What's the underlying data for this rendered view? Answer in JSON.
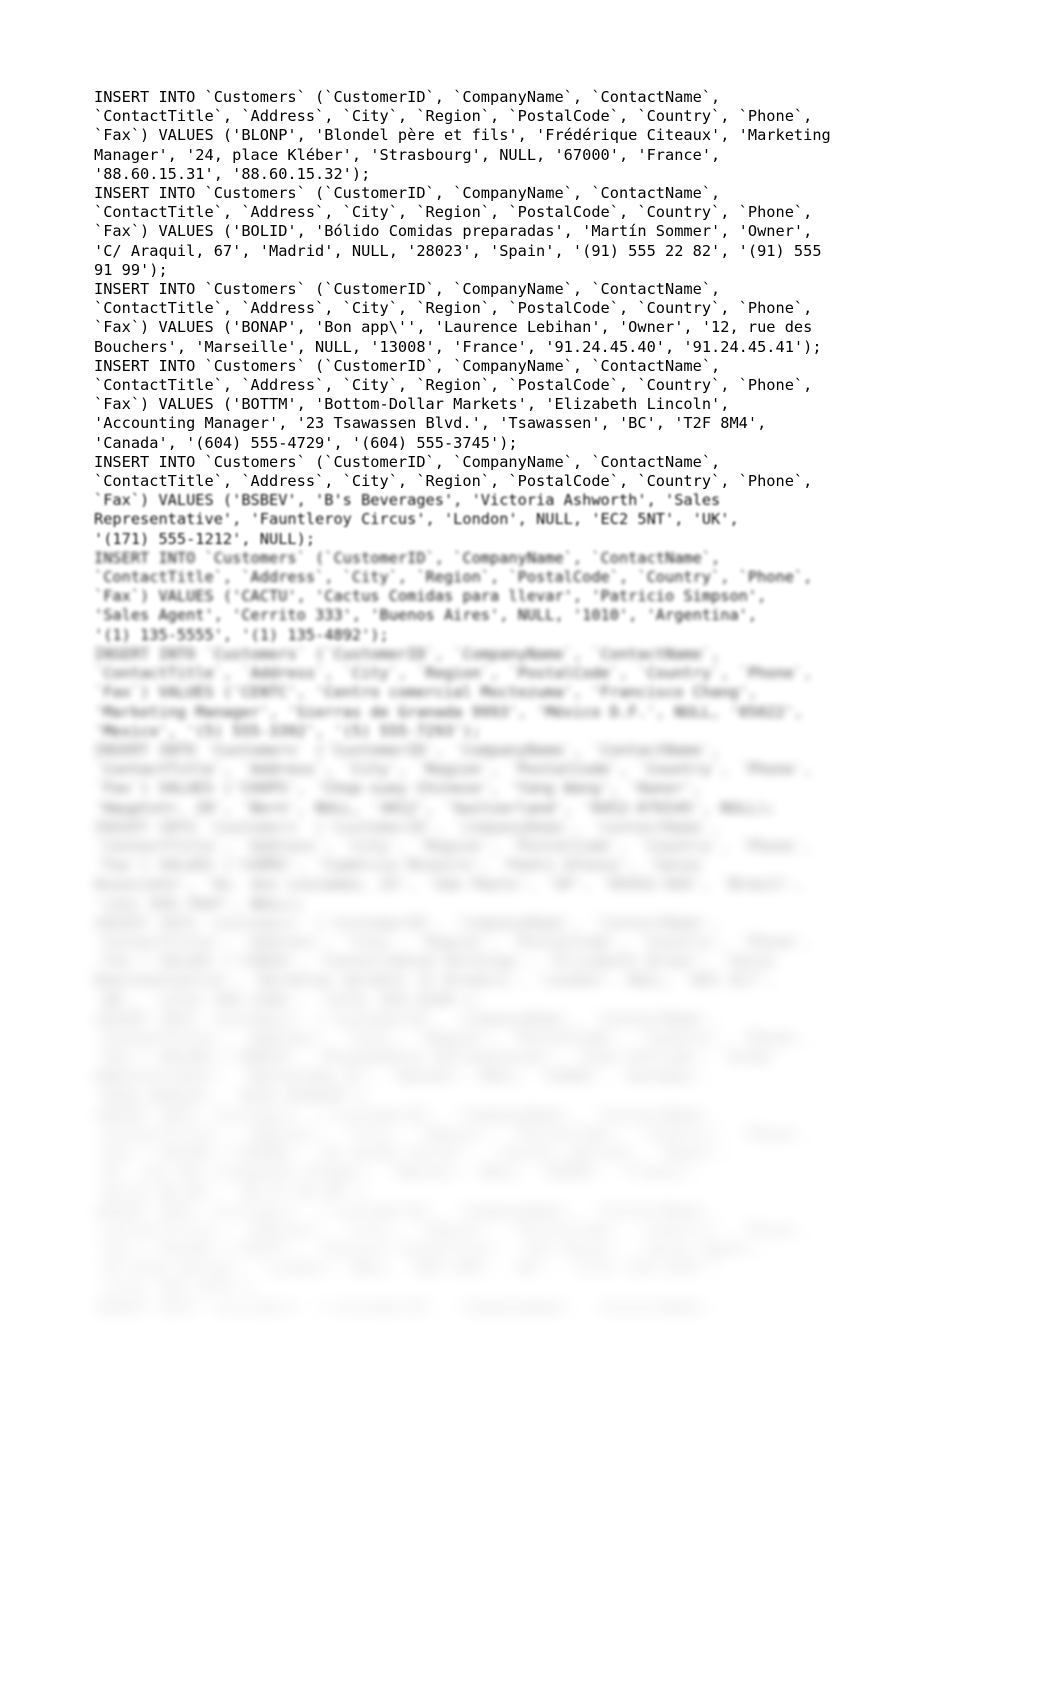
{
  "document": {
    "type": "sql-dump",
    "text_color": "#000000",
    "background_color": "#ffffff",
    "font_size_px": 15.3,
    "line_height_px": 19.2,
    "statements": [
      {
        "id": "stmt-blonp",
        "sharp": true,
        "lines": [
          "INSERT INTO `Customers` (`CustomerID`, `CompanyName`, `ContactName`,",
          "`ContactTitle`, `Address`, `City`, `Region`, `PostalCode`, `Country`, `Phone`,",
          "`Fax`) VALUES ('BLONP', 'Blondel père et fils', 'Frédérique Citeaux', 'Marketing",
          "Manager', '24, place Kléber', 'Strasbourg', NULL, '67000', 'France',",
          "'88.60.15.31', '88.60.15.32');"
        ]
      },
      {
        "id": "stmt-bolid",
        "sharp": true,
        "lines": [
          "INSERT INTO `Customers` (`CustomerID`, `CompanyName`, `ContactName`,",
          "`ContactTitle`, `Address`, `City`, `Region`, `PostalCode`, `Country`, `Phone`,",
          "`Fax`) VALUES ('BOLID', 'Bólido Comidas preparadas', 'Martín Sommer', 'Owner',",
          "'C/ Araquil, 67', 'Madrid', NULL, '28023', 'Spain', '(91) 555 22 82', '(91) 555",
          "91 99');"
        ]
      },
      {
        "id": "stmt-bonap",
        "sharp": true,
        "lines": [
          "INSERT INTO `Customers` (`CustomerID`, `CompanyName`, `ContactName`,",
          "`ContactTitle`, `Address`, `City`, `Region`, `PostalCode`, `Country`, `Phone`,",
          "`Fax`) VALUES ('BONAP', 'Bon app\\'', 'Laurence Lebihan', 'Owner', '12, rue des",
          "Bouchers', 'Marseille', NULL, '13008', 'France', '91.24.45.40', '91.24.45.41');"
        ]
      },
      {
        "id": "stmt-bottm",
        "sharp": true,
        "lines": [
          "INSERT INTO `Customers` (`CustomerID`, `CompanyName`, `ContactName`,",
          "`ContactTitle`, `Address`, `City`, `Region`, `PostalCode`, `Country`, `Phone`,",
          "`Fax`) VALUES ('BOTTM', 'Bottom-Dollar Markets', 'Elizabeth Lincoln',",
          "'Accounting Manager', '23 Tsawassen Blvd.', 'Tsawassen', 'BC', 'T2F 8M4',",
          "'Canada', '(604) 555-4729', '(604) 555-3745');"
        ]
      },
      {
        "id": "stmt-bsbev-header",
        "sharp": true,
        "lines": [
          "INSERT INTO `Customers` (`CustomerID`, `CompanyName`, `ContactName`,",
          "`ContactTitle`, `Address`, `City`, `Region`, `PostalCode`, `Country`, `Phone`,"
        ]
      }
    ],
    "blurred_continuation": {
      "note": "Remaining statements are rendered out-of-focus with increasing blur toward the bottom of the page.",
      "blocks": [
        {
          "blur_level": 1,
          "lines": [
            "`Fax`) VALUES ('BSBEV', 'B's Beverages', 'Victoria Ashworth', 'Sales",
            "Representative', 'Fauntleroy Circus', 'London', NULL, 'EC2 5NT', 'UK',",
            "'(171) 555-1212', NULL);"
          ]
        },
        {
          "blur_level": 2,
          "lines": [
            "INSERT INTO `Customers` (`CustomerID`, `CompanyName`, `ContactName`,",
            "`ContactTitle`, `Address`, `City`, `Region`, `PostalCode`, `Country`, `Phone`,",
            "`Fax`) VALUES ('CACTU', 'Cactus Comidas para llevar', 'Patricio Simpson',",
            "'Sales Agent', 'Cerrito 333', 'Buenos Aires', NULL, '1010', 'Argentina',",
            "'(1) 135-5555', '(1) 135-4892');"
          ]
        },
        {
          "blur_level": 4,
          "lines": [
            "INSERT INTO `Customers` (`CustomerID`, `CompanyName`, `ContactName`,",
            "`ContactTitle`, `Address`, `City`, `Region`, `PostalCode`, `Country`, `Phone`,",
            "`Fax`) VALUES ('CENTC', 'Centro comercial Moctezuma', 'Francisco Chang',",
            "'Marketing Manager', 'Sierras de Granada 9993', 'México D.F.', NULL, '05022',",
            "'Mexico', '(5) 555-3392', '(5) 555-7293');"
          ]
        },
        {
          "blur_level": 6,
          "lines": [
            "INSERT INTO `Customers` (`CustomerID`, `CompanyName`, `ContactName`,",
            "`ContactTitle`, `Address`, `City`, `Region`, `PostalCode`, `Country`, `Phone`,",
            "`Fax`) VALUES ('CHOPS', 'Chop-suey Chinese', 'Yang Wang', 'Owner',",
            "'Hauptstr. 29', 'Bern', NULL, '3012', 'Switzerland', '0452-076545', NULL);"
          ]
        },
        {
          "blur_level": 8,
          "lines": [
            "INSERT INTO `Customers` (`CustomerID`, `CompanyName`, `ContactName`,",
            "`ContactTitle`, `Address`, `City`, `Region`, `PostalCode`, `Country`, `Phone`,",
            "`Fax`) VALUES ('COMMI', 'Comércio Mineiro', 'Pedro Afonso', 'Sales",
            "Associate', 'Av. dos Lusíadas, 23', 'Sao Paulo', 'SP', '05432-043', 'Brazil',",
            "'(11) 555-7647', NULL);"
          ]
        },
        {
          "blur_level": 10,
          "lines": [
            "INSERT INTO `Customers` (`CustomerID`, `CompanyName`, `ContactName`,",
            "`ContactTitle`, `Address`, `City`, `Region`, `PostalCode`, `Country`, `Phone`,",
            "`Fax`) VALUES ('CONSH', 'Consolidated Holdings', 'Elizabeth Brown', 'Sales",
            "Representative', 'Berkeley Gardens 12 Brewery', 'London', NULL, 'WX1 6LT',",
            "'UK', '(171) 555-2282', '(171) 555-9199');"
          ]
        },
        {
          "blur_level": 12,
          "lines": [
            "INSERT INTO `Customers` (`CustomerID`, `CompanyName`, `ContactName`,",
            "`ContactTitle`, `Address`, `City`, `Region`, `PostalCode`, `Country`, `Phone`,",
            "`Fax`) VALUES ('DRACD', 'Drachenblut Delikatessen', 'Sven Ottlieb', 'Order",
            "Administrator', 'Walserweg 21', 'Aachen', NULL, '52066', 'Germany',",
            "'0241-039123', '0241-059428');"
          ]
        },
        {
          "blur_level": 14,
          "lines": [
            "INSERT INTO `Customers` (`CustomerID`, `CompanyName`, `ContactName`,",
            "`ContactTitle`, `Address`, `City`, `Region`, `PostalCode`, `Country`, `Phone`,",
            "`Fax`) VALUES ('DUMON', 'Du monde entier', 'Janine Labrune', 'Owner',",
            "'67, rue des Cinquante Otages', 'Nantes', NULL, '44000', 'France',",
            "'40.67.88.88', '40.67.89.89');"
          ]
        },
        {
          "blur_level": 15,
          "lines": [
            "INSERT INTO `Customers` (`CustomerID`, `CompanyName`, `ContactName`,",
            "`ContactTitle`, `Address`, `City`, `Region`, `PostalCode`, `Country`, `Phone`,",
            "`Fax`) VALUES ('EASTC', 'Eastern Connection', 'Ann Devon', 'Sales Agent',",
            "'35 King George', 'London', NULL, 'WX3 6FW', 'UK', '(171) 555-0297',",
            "'(171) 555-3373');"
          ]
        },
        {
          "blur_level": 16,
          "lines": [
            "INSERT INTO `Customers` (`CustomerID`, `CompanyName`, `ContactName`,"
          ]
        }
      ]
    }
  }
}
